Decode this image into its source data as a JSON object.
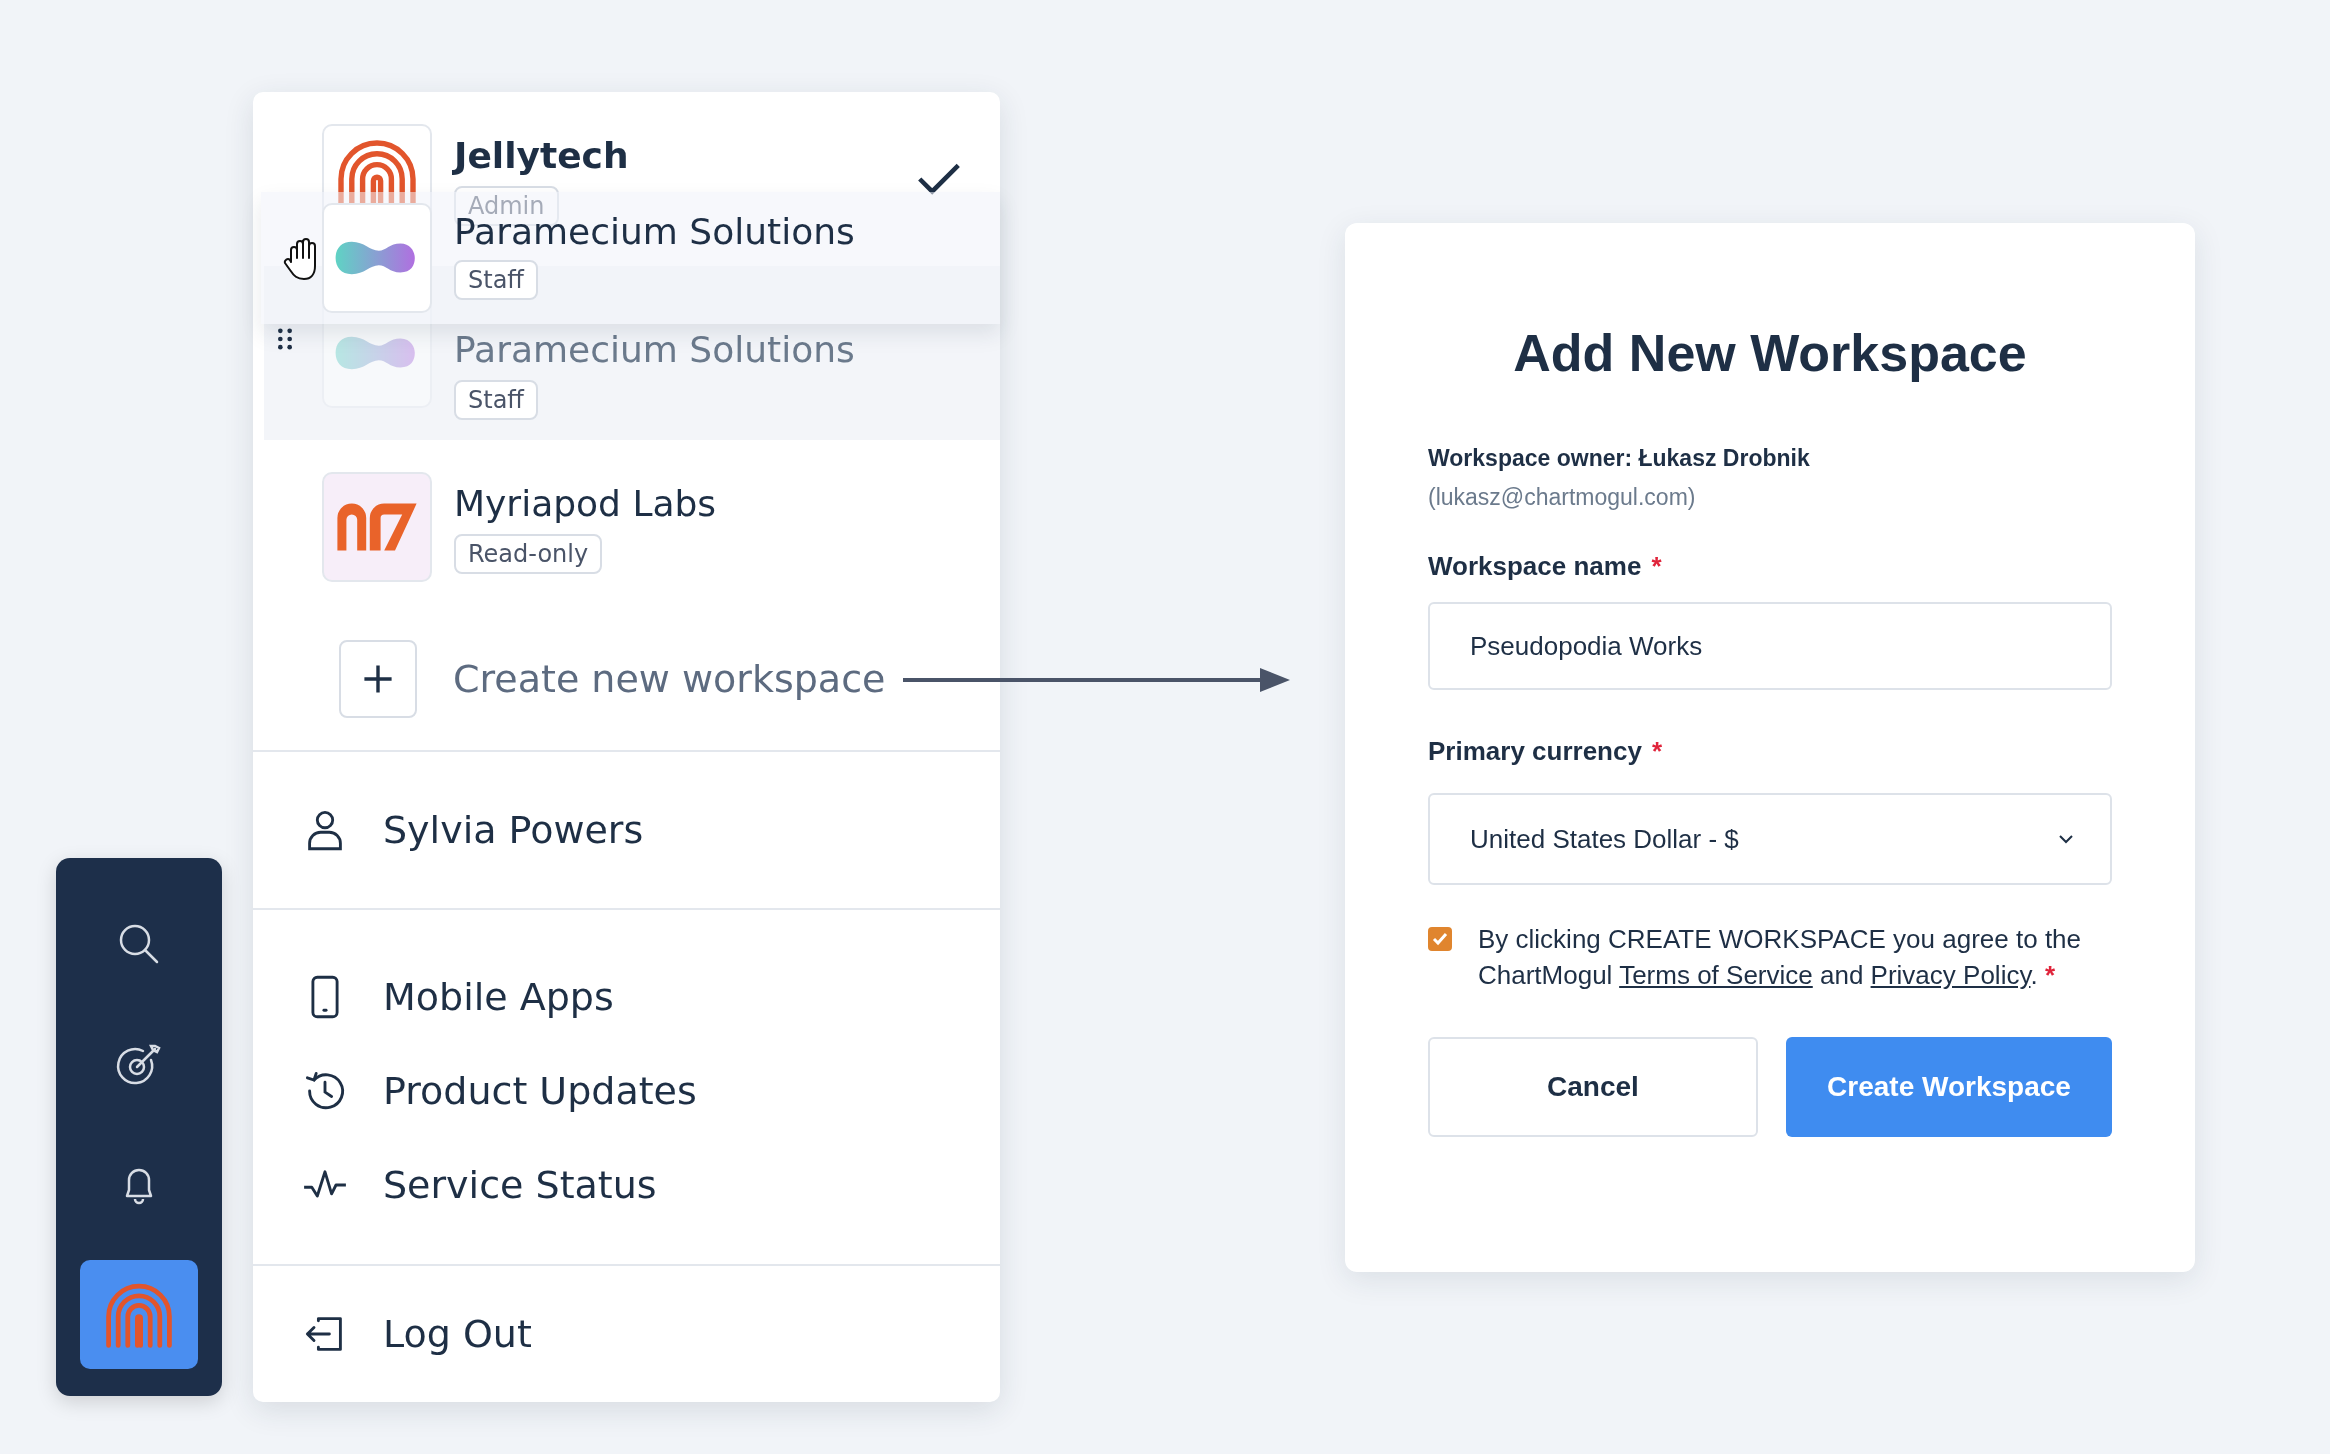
{
  "sidebar": {
    "items": [
      {
        "kind": "search",
        "selected": false
      },
      {
        "kind": "target",
        "selected": false
      },
      {
        "kind": "bell",
        "selected": false
      },
      {
        "kind": "logo",
        "selected": true
      }
    ]
  },
  "workspaces": [
    {
      "name": "Jellytech",
      "role": "Admin",
      "kind": "fingerprint",
      "selected": true,
      "dragging": false
    },
    {
      "name": "Paramecium Solutions",
      "role": "Staff",
      "kind": "blob",
      "selected": false,
      "dragging": true
    },
    {
      "name": "Myriapod Labs",
      "role": "Read-only",
      "kind": "mark",
      "selected": false,
      "dragging": false
    }
  ],
  "drag_ghost": {
    "name": "Paramecium Solutions",
    "role": "Staff",
    "kind": "blob"
  },
  "create_workspace": "Create new workspace",
  "user": {
    "name": "Sylvia Powers"
  },
  "links": [
    {
      "label": "Mobile Apps",
      "kind": "phone"
    },
    {
      "label": "Product Updates",
      "kind": "history"
    },
    {
      "label": "Service Status",
      "kind": "pulse"
    }
  ],
  "logout": "Log Out",
  "dialog": {
    "title": "Add New Workspace",
    "owner": "Workspace owner: Łukasz Drobnik",
    "owner_email": "(lukasz@chartmogul.com)",
    "name_label": "Workspace name",
    "name_required": "*",
    "name_value": "Pseudopodia Works",
    "currency_label": "Primary currency",
    "currency_required": "*",
    "currency_value": "United States Dollar - $",
    "agree": {
      "checked": true,
      "text_before": "By clicking CREATE WORKSPACE you agree to the ChartMogul ",
      "terms_link": "Terms of Service",
      "middle": " and ",
      "privacy_link": "Privacy Policy",
      "end": ".",
      "required": "*"
    },
    "buttons": [
      {
        "label": "Cancel",
        "kind": "secondary"
      },
      {
        "label": "Create Workspace",
        "kind": "primary"
      }
    ]
  }
}
